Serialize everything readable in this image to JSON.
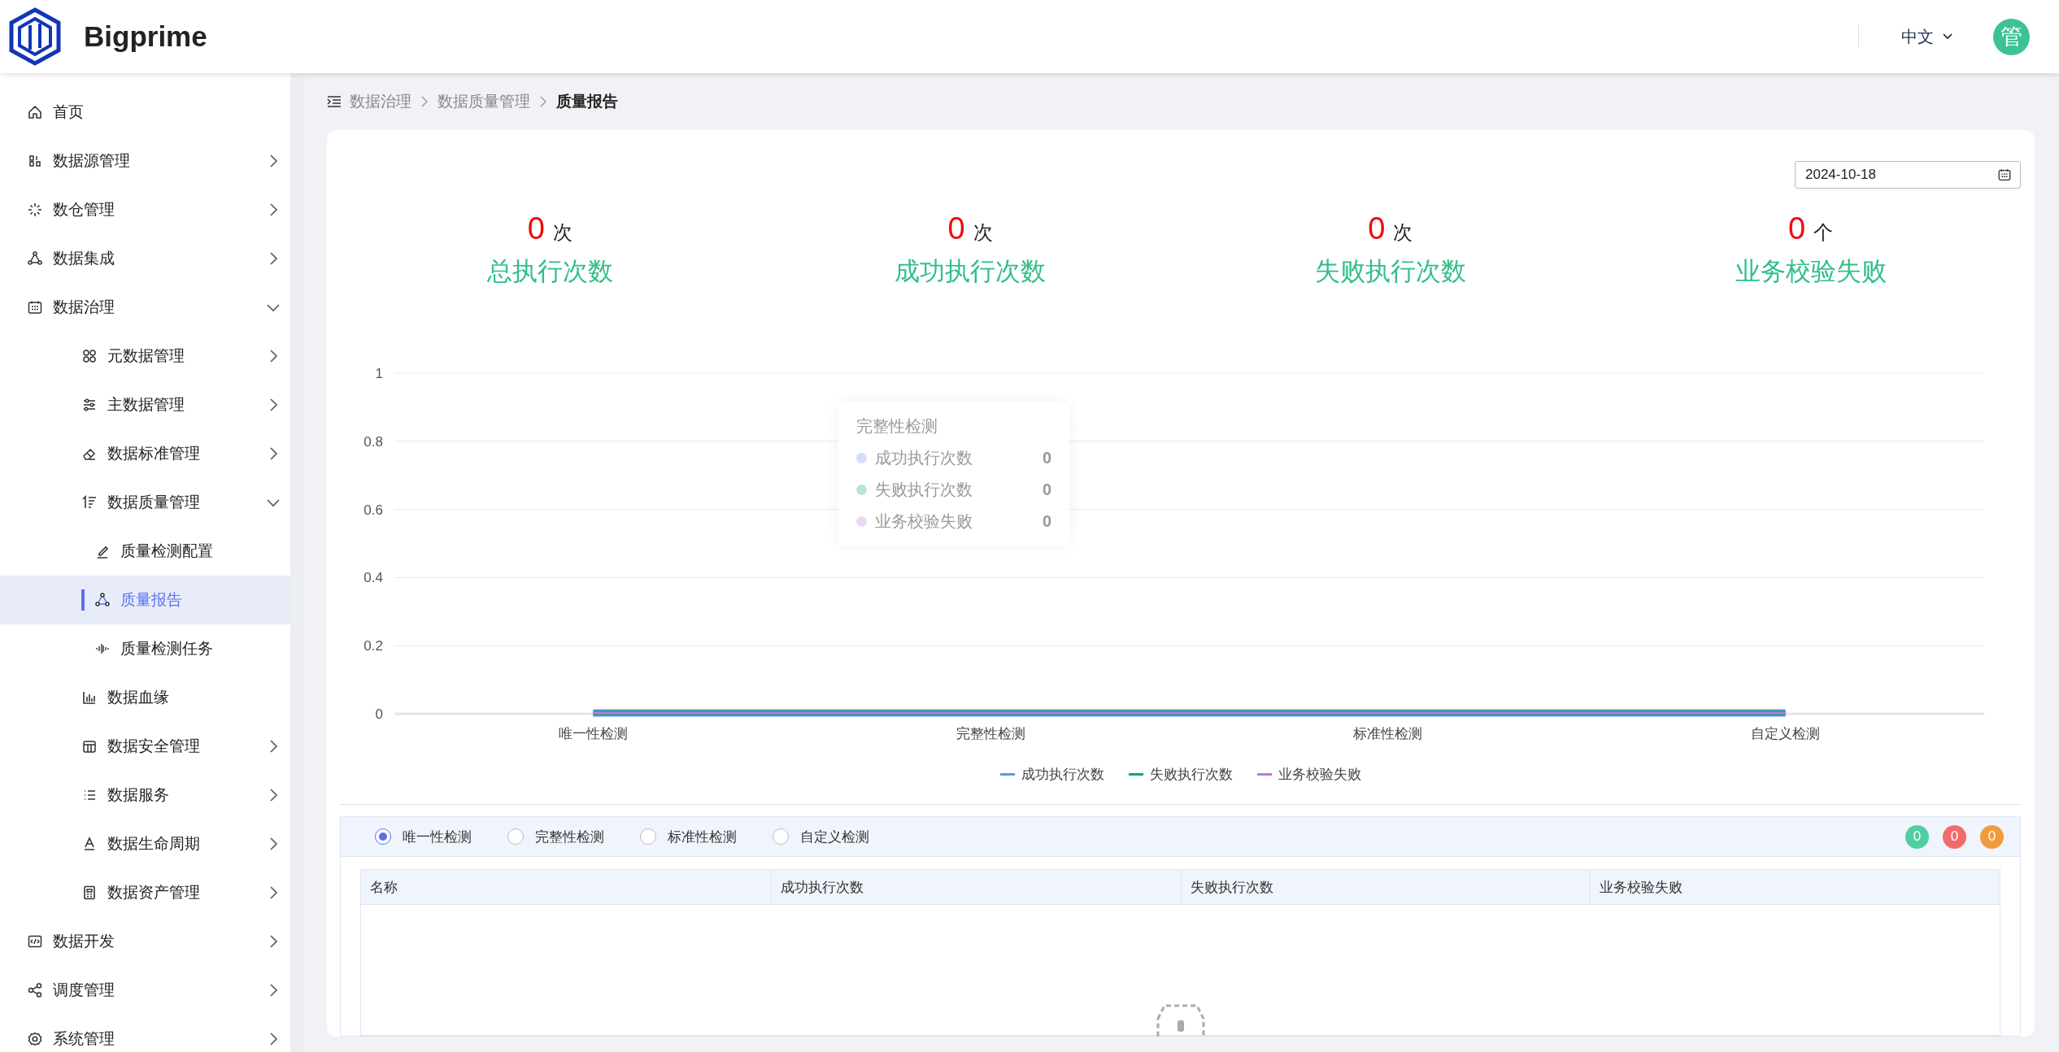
{
  "header": {
    "brand": "Bigprime",
    "language": "中文",
    "avatar": "管"
  },
  "sidebar": {
    "items": [
      {
        "label": "首页",
        "selected": false
      },
      {
        "label": "数据源管理",
        "selected": false,
        "expanded": false
      },
      {
        "label": "数仓管理",
        "selected": false,
        "expanded": false
      },
      {
        "label": "数据集成",
        "selected": false,
        "expanded": false
      },
      {
        "label": "数据治理",
        "selected": false,
        "expanded": true,
        "children": [
          {
            "label": "元数据管理",
            "selected": false,
            "expanded": false
          },
          {
            "label": "主数据管理",
            "selected": false,
            "expanded": false
          },
          {
            "label": "数据标准管理",
            "selected": false,
            "expanded": false
          },
          {
            "label": "数据质量管理",
            "selected": false,
            "expanded": true,
            "children": [
              {
                "label": "质量检测配置",
                "selected": false
              },
              {
                "label": "质量报告",
                "selected": true
              },
              {
                "label": "质量检测任务",
                "selected": false
              }
            ]
          },
          {
            "label": "数据血缘",
            "selected": false
          },
          {
            "label": "数据安全管理",
            "selected": false,
            "expanded": false
          },
          {
            "label": "数据服务",
            "selected": false,
            "expanded": false
          },
          {
            "label": "数据生命周期",
            "selected": false,
            "expanded": false
          },
          {
            "label": "数据资产管理",
            "selected": false,
            "expanded": false
          }
        ]
      },
      {
        "label": "数据开发",
        "selected": false,
        "expanded": false
      },
      {
        "label": "调度管理",
        "selected": false,
        "expanded": false
      },
      {
        "label": "系统管理",
        "selected": false,
        "expanded": false
      }
    ]
  },
  "breadcrumb": [
    "数据治理",
    "数据质量管理",
    "质量报告"
  ],
  "date_field": {
    "value": "2024-10-18"
  },
  "stats": [
    {
      "value": "0",
      "unit": "次",
      "label": "总执行次数"
    },
    {
      "value": "0",
      "unit": "次",
      "label": "成功执行次数"
    },
    {
      "value": "0",
      "unit": "次",
      "label": "失败执行次数"
    },
    {
      "value": "0",
      "unit": "个",
      "label": "业务校验失败"
    }
  ],
  "chart": {
    "chart_data": {
      "type": "line",
      "categories": [
        "唯一性检测",
        "完整性检测",
        "标准性检测",
        "自定义检测"
      ],
      "series": [
        {
          "name": "成功执行次数",
          "color": "#6b8ef5",
          "values": [
            0,
            0,
            0,
            0
          ]
        },
        {
          "name": "失败执行次数",
          "color": "#10a86b",
          "values": [
            0,
            0,
            0,
            0
          ]
        },
        {
          "name": "业务校验失败",
          "color": "#b57be8",
          "values": [
            0,
            0,
            0,
            0
          ]
        }
      ],
      "grid": true,
      "ylim": [
        0,
        1
      ],
      "yticks": [
        0,
        0.2,
        0.4,
        0.6,
        0.8,
        1
      ]
    },
    "tooltip": {
      "title": "完整性检测",
      "rows": [
        {
          "label": "成功执行次数",
          "value": "0"
        },
        {
          "label": "失败执行次数",
          "value": "0"
        },
        {
          "label": "业务校验失败",
          "value": "0"
        }
      ]
    }
  },
  "check_types": [
    {
      "label": "唯一性检测",
      "selected": true
    },
    {
      "label": "完整性检测",
      "selected": false
    },
    {
      "label": "标准性检测",
      "selected": false
    },
    {
      "label": "自定义检测",
      "selected": false
    }
  ],
  "counters": [
    {
      "value": "0",
      "color": "#4fcf9f"
    },
    {
      "value": "0",
      "color": "#f26b6b"
    },
    {
      "value": "0",
      "color": "#f39a3a"
    }
  ],
  "table": {
    "columns": [
      "名称",
      "成功执行次数",
      "失败执行次数",
      "业务校验失败"
    ]
  }
}
